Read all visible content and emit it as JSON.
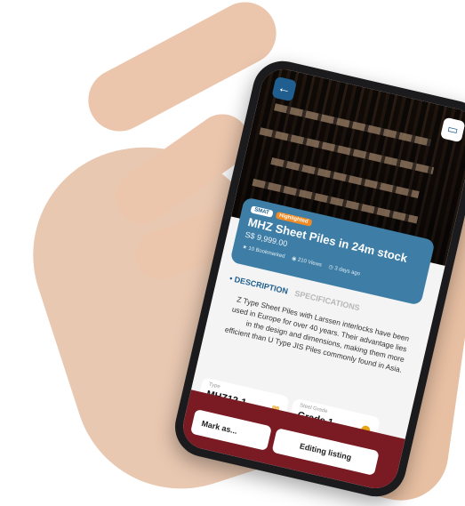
{
  "header": {
    "back_icon": "arrow-left-icon",
    "chat_icon": "chat-icon"
  },
  "listing": {
    "tags": [
      "SMAT",
      "Highlighted"
    ],
    "title": "MHZ Sheet Piles in 24m stock",
    "price": "S$ 9,999.00",
    "bookmarked": "10 Bookmarked",
    "views": "210 Views",
    "posted": "3 days ago"
  },
  "tabs": {
    "active": "DESCRIPTION",
    "inactive": "SPECIFICATIONS"
  },
  "description": "Z Type Sheet Piles with Larssen interlocks have been used in Europe for over 40 years. Their advantage lies in the design and dimensions, making them more efficient than U Type JIS Piles commonly found in Asia.",
  "specs": {
    "type_label": "Type",
    "type_value": "MHZ12-1",
    "grade_label": "Steel Grade",
    "grade_value": "Grade 1"
  },
  "actions": {
    "mark": "Mark as...",
    "edit": "Editing listing"
  },
  "colors": {
    "brand_blue": "#3e7ea6",
    "dark_blue": "#1f5e8e",
    "accent_orange": "#e8a317",
    "footer_maroon": "#7a1a22"
  }
}
